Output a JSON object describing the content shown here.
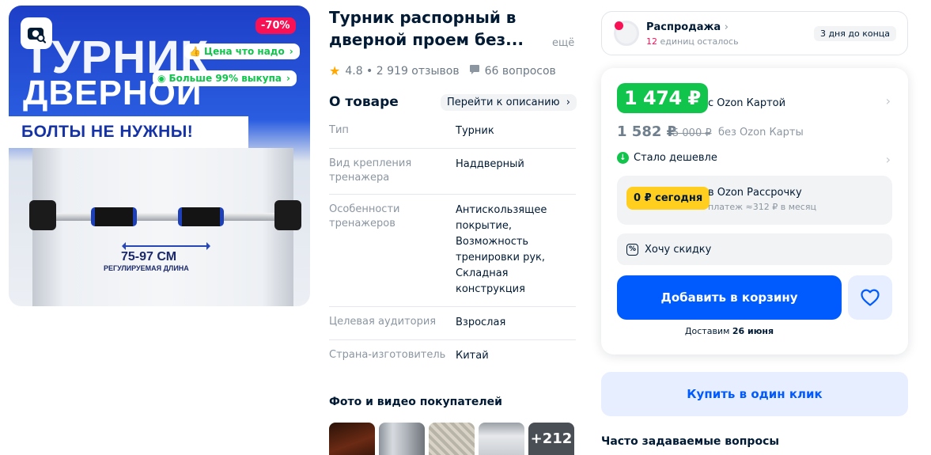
{
  "image": {
    "headline_1": "Турник",
    "headline_2": "дверной",
    "bolts_text": "БОЛТЫ НЕ НУЖНЫ!",
    "range": "75-97 СМ",
    "range_sub": "РЕГУЛИРУЕМАЯ ДЛИНА",
    "discount_badge": "-70%",
    "pill_price": "Цена что надо",
    "pill_buyout": "Больше 99% выкупа",
    "camera_icon": "camera-search-icon"
  },
  "product": {
    "title_line1": "Турник распорный в",
    "title_line2": "дверной проем без...",
    "more": "ещё",
    "rating": "4.8",
    "reviews": "2 919 отзывов",
    "questions": "66 вопросов"
  },
  "about": {
    "heading": "О товаре",
    "goto": "Перейти к описанию",
    "specs": [
      {
        "key": "Тип",
        "value": "Турник"
      },
      {
        "key": "Вид крепления тренажера",
        "value": "Наддверный"
      },
      {
        "key": "Особенности тренажеров",
        "value": "Антискользящее покрытие, Возможность тренировки рук, Складная конструкция"
      },
      {
        "key": "Целевая аудитория",
        "value": "Взрослая"
      },
      {
        "key": "Страна-изготовитель",
        "value": "Китай"
      }
    ]
  },
  "photos": {
    "heading": "Фото и видео покупателей",
    "more_count": "+212"
  },
  "sale": {
    "title": "Распродажа",
    "left_count": "12",
    "left_text": "единиц осталось",
    "ends": "3 дня до конца"
  },
  "price": {
    "ozon_price": "1 474 ₽",
    "with_card": "с Ozon Картой",
    "regular": "1 582 ₽",
    "old": "5 000 ₽",
    "no_card": "без Ozon Карты",
    "cheaper": "Стало дешевле",
    "install_badge": "0 ₽ сегодня",
    "install_title": "в Ozon Рассрочку",
    "install_sub": "платеж ≈312 ₽ в месяц",
    "want_discount": "Хочу скидку",
    "add_to_cart": "Добавить в корзину",
    "delivery_prefix": "Доставим",
    "delivery_date": "26 июня"
  },
  "buy_one_click": "Купить в один клик",
  "faq_heading": "Часто задаваемые вопросы",
  "colors": {
    "green": "#10c44c",
    "blue": "#005bff",
    "pink": "#f91155",
    "yellow": "#ffce1f"
  }
}
